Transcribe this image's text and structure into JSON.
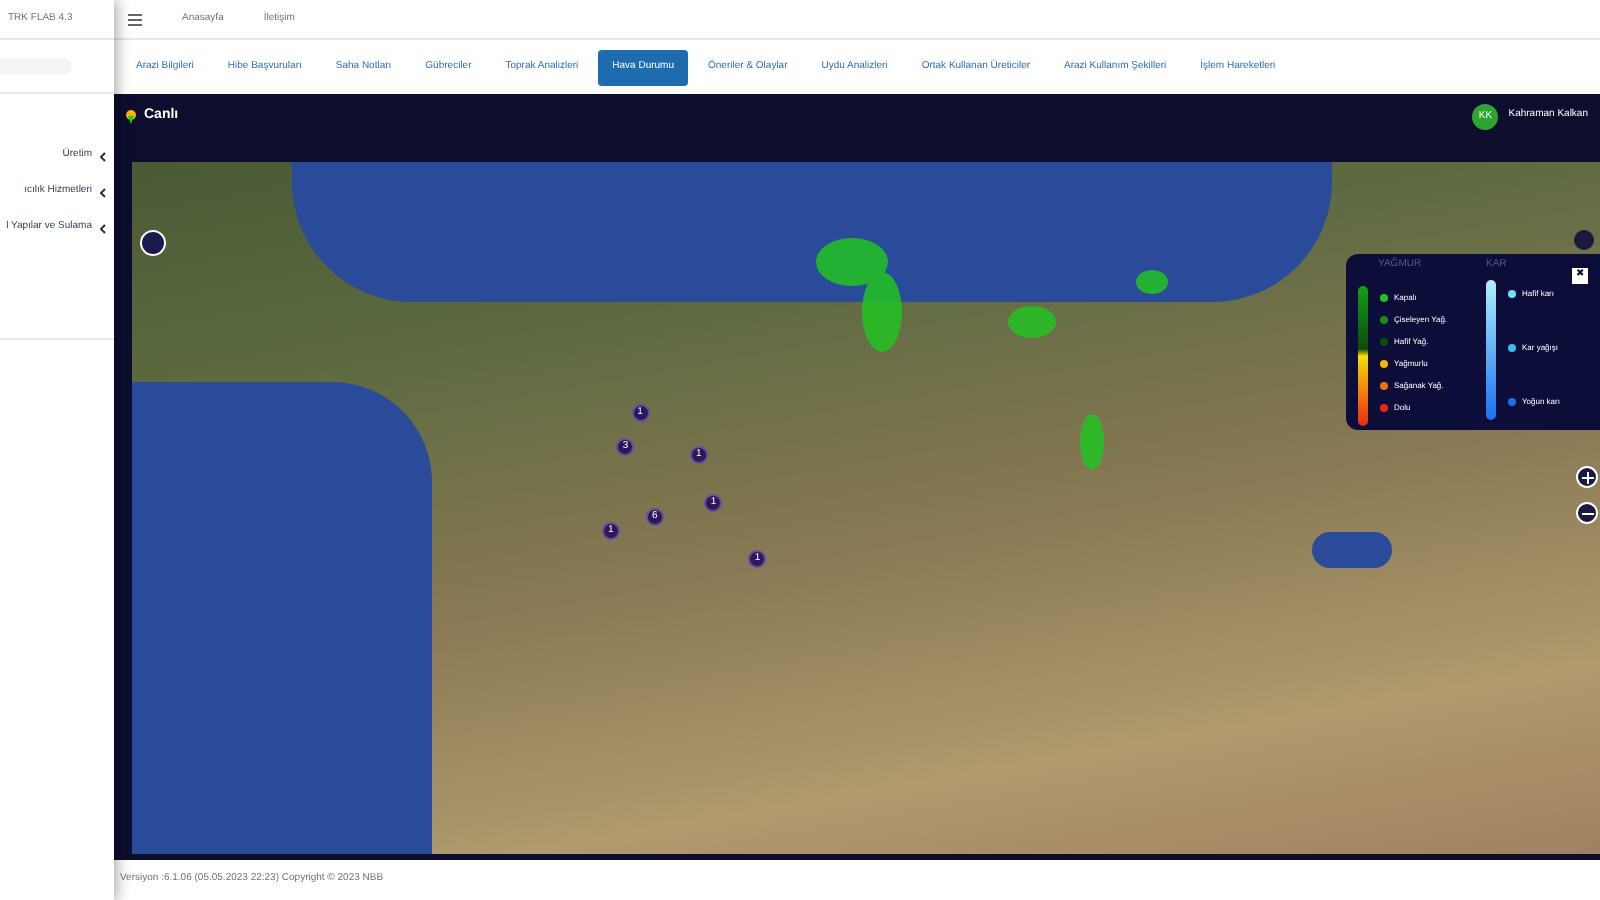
{
  "sidebar": {
    "brand": "TRK FLAB 4.3",
    "items": [
      {
        "label": "Üretim"
      },
      {
        "label": "ıcılık Hizmetleri"
      },
      {
        "label": "l Yapılar ve Sulama"
      }
    ]
  },
  "topbar": {
    "links": [
      "Anasayfa",
      "İletişim"
    ]
  },
  "tabs": [
    {
      "label": "Arazi Bilgileri",
      "selected": false
    },
    {
      "label": "Hibe Başvuruları",
      "selected": false
    },
    {
      "label": "Saha Notları",
      "selected": false
    },
    {
      "label": "Gübreciler",
      "selected": false
    },
    {
      "label": "Toprak Analizleri",
      "selected": false
    },
    {
      "label": "Hava Durumu",
      "selected": true
    },
    {
      "label": "Öneriler & Olaylar",
      "selected": false
    },
    {
      "label": "Uydu Analizleri",
      "selected": false
    },
    {
      "label": "Ortak Kullanan Üreticiler",
      "selected": false
    },
    {
      "label": "Arazi Kullanım Şekilleri",
      "selected": false
    },
    {
      "label": "İşlem Hareketleri",
      "selected": false
    }
  ],
  "panel": {
    "title": "Canlı",
    "user": {
      "initials": "KK",
      "name": "Kahraman Kalkan"
    }
  },
  "map": {
    "markers": [
      {
        "count": "3"
      },
      {
        "count": "6"
      },
      {
        "count": "1"
      },
      {
        "count": "1"
      },
      {
        "count": "1"
      },
      {
        "count": "1"
      },
      {
        "count": "1"
      }
    ],
    "legend": {
      "rain_title": "YAĞMUR",
      "snow_title": "KAR",
      "close": "✖",
      "rain": [
        {
          "label": "Kapalı",
          "color": "#22c322"
        },
        {
          "label": "Çiseleyen Yağ.",
          "color": "#14901a"
        },
        {
          "label": "Hafif Yağ.",
          "color": "#0c4a10"
        },
        {
          "label": "Yağmurlu",
          "color": "#f5b800"
        },
        {
          "label": "Sağanak Yağ.",
          "color": "#f07010"
        },
        {
          "label": "Dolu",
          "color": "#e82a10"
        }
      ],
      "snow": [
        {
          "label": "Hafif karı",
          "color": "#6ee0f5"
        },
        {
          "label": "Kar yağışı",
          "color": "#40b8f0"
        },
        {
          "label": "Yoğun karı",
          "color": "#1a70f0"
        }
      ]
    }
  },
  "footer": "Versiyon :6.1.06 (05.05.2023 22:23) Copyright © 2023 NBB"
}
